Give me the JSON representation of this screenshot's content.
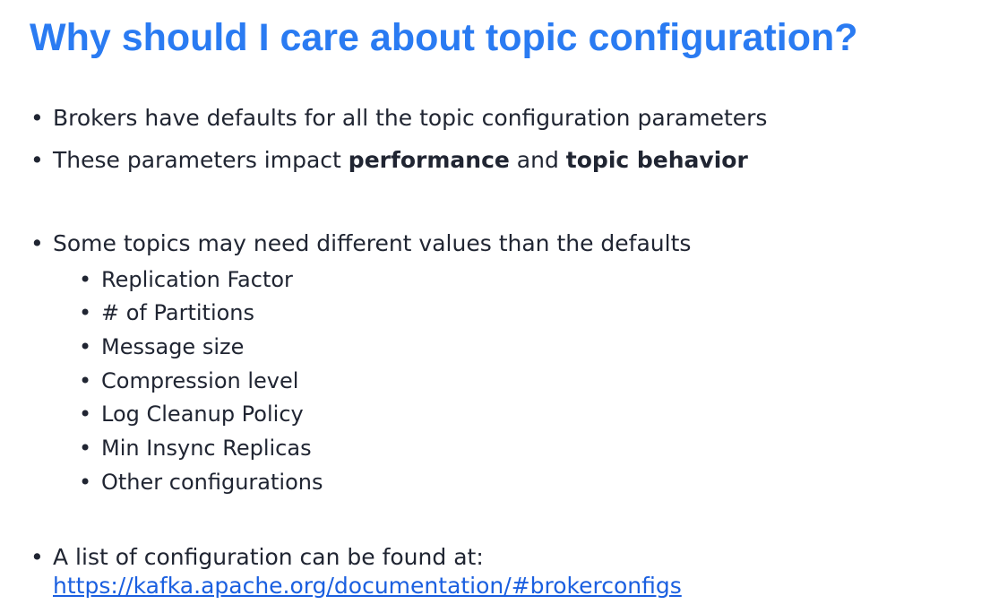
{
  "slide": {
    "title": "Why should I care about topic configuration?",
    "bullet_char": "•",
    "bullets": [
      {
        "text": "Brokers have defaults for all the topic configuration parameters"
      },
      {
        "parts": [
          "These parameters impact ",
          "performance",
          " and ",
          "topic behavior"
        ]
      },
      {
        "text": "Some topics may need different values than the defaults",
        "sub": [
          "Replication Factor",
          "# of Partitions",
          "Message size",
          "Compression level",
          "Log Cleanup Policy",
          "Min Insync Replicas",
          "Other configurations"
        ]
      },
      {
        "text": "A list of configuration can be found at:",
        "link": "https://kafka.apache.org/documentation/#brokerconfigs"
      }
    ]
  }
}
